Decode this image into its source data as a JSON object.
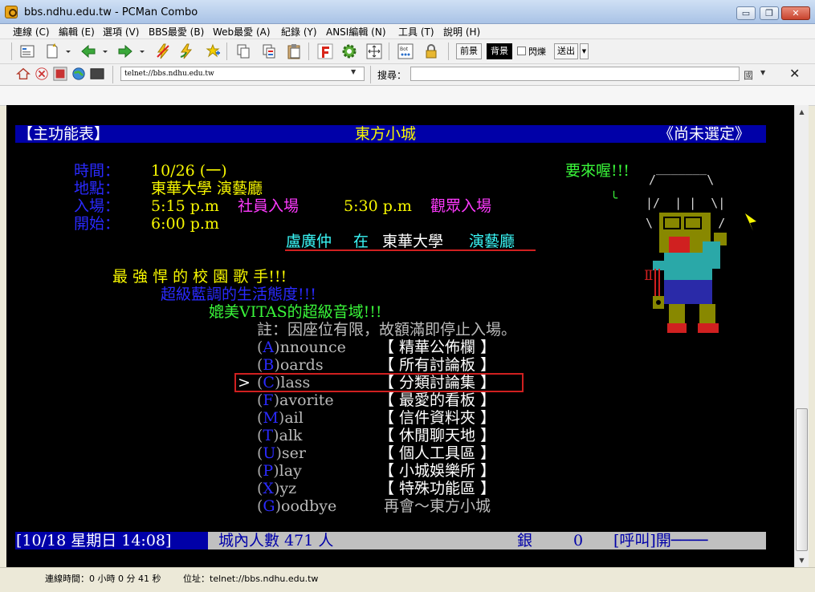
{
  "window": {
    "title": "bbs.ndhu.edu.tw - PCMan Combo",
    "minimize_glyph": "▭",
    "maximize_glyph": "❐",
    "close_glyph": "✕"
  },
  "menu": {
    "items": [
      "連線 (C)",
      "編輯 (E)",
      "選項 (V)",
      "BBS最愛 (B)",
      "Web最愛 (A)",
      "紀錄 (Y)",
      "ANSI編輯 (N)",
      "工具 (T)",
      "說明 (H)"
    ]
  },
  "toolbar": {
    "fg_label": "前景",
    "bg_label": "背景",
    "blink_label": "閃爍",
    "send_label": "送出"
  },
  "address": {
    "value": "telnet://bbs.ndhu.edu.tw",
    "search_label": "搜尋：",
    "search_placeholder": "",
    "lang_label": "國"
  },
  "terminal": {
    "header": {
      "left": "【主功能表】",
      "center": "東方小城",
      "right": "《尚未選定》"
    },
    "event": {
      "time_label": "時間：",
      "time_value": "10/26 (一)",
      "place_label": "地點：",
      "place_value": "東華大學 演藝廳",
      "entry_label": "入場：",
      "entry_time1": "5:15 p.m",
      "entry_group1": "社員入場",
      "entry_time2": "5:30 p.m",
      "entry_group2": "觀眾入場",
      "start_label": "開始：",
      "start_value": "6:00 p.m",
      "performer": "盧廣仲",
      "at": "在",
      "venue_school": "東華大學",
      "venue_hall": "演藝廳"
    },
    "slogans": {
      "line1": "最 強 悍 的 校 園 歌 手!!!",
      "line2": "超級藍調的生活態度!!!",
      "line3": "媲美VITAS的超級音域!!!",
      "note": "註：因座位有限，故額滿即停止入場。",
      "come": "要來喔!!!"
    },
    "menu_cursor": ">",
    "menu_options": [
      {
        "key": "A",
        "rest": "nnounce",
        "desc": "精華公佈欄"
      },
      {
        "key": "B",
        "rest": "oards",
        "desc": "所有討論板"
      },
      {
        "key": "C",
        "rest": "lass",
        "desc": "分類討論集"
      },
      {
        "key": "F",
        "rest": "avorite",
        "desc": "最愛的看板"
      },
      {
        "key": "M",
        "rest": "ail",
        "desc": "信件資料夾"
      },
      {
        "key": "T",
        "rest": "alk",
        "desc": "休閒聊天地"
      },
      {
        "key": "U",
        "rest": "ser",
        "desc": "個人工具區"
      },
      {
        "key": "P",
        "rest": "lay",
        "desc": "小城娛樂所"
      },
      {
        "key": "X",
        "rest": "yz",
        "desc": "特殊功能區"
      }
    ],
    "goodbye": {
      "key": "G",
      "rest": "oodbye",
      "desc": "再會～東方小城"
    },
    "footer": {
      "date": "[10/18 星期日 14:08]",
      "users": "城內人數 471 人",
      "silver_label": "銀",
      "silver_value": "0",
      "call": "[呼叫]開────"
    },
    "art": {
      "line1": "/‾‾‾‾‾‾‾\\",
      "line2": "|/  | |  \\|",
      "line3": "\\    |    /",
      "figure_mark": "Ⅱ"
    }
  },
  "status": {
    "connect_time": "連線時間：0 小時 0 分 41 秒",
    "address": "位址：telnet://bbs.ndhu.edu.tw"
  }
}
